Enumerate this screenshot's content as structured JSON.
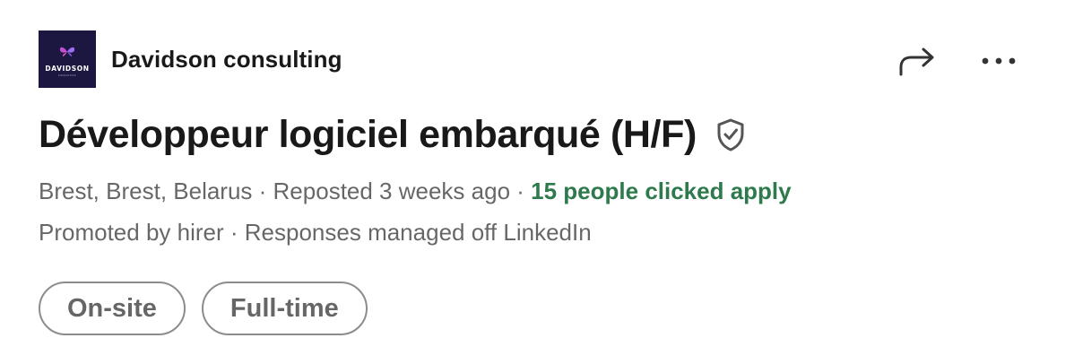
{
  "company": {
    "logo_word": "DAVIDSON",
    "logo_sub": "CONSULTING",
    "name": "Davidson consulting",
    "logo_bg": "#1b1740",
    "logo_accent": "#c14fd6"
  },
  "actions": {
    "share_icon": "share-arrow-icon",
    "more_icon": "ellipsis-icon"
  },
  "job": {
    "title": "Développeur logiciel embarqué (H/F)",
    "verified_icon": "verified-shield-icon"
  },
  "meta": {
    "location": "Brest, Brest, Belarus",
    "sep1": " · ",
    "posted": "Reposted 3 weeks ago",
    "sep2": " · ",
    "applicants": "15 people clicked apply",
    "applicants_color": "#2f7a4d",
    "promoted": "Promoted by hirer",
    "sep3": " · ",
    "responses": "Responses managed off LinkedIn"
  },
  "pills": {
    "workplace": "On-site",
    "job_type": "Full-time"
  }
}
